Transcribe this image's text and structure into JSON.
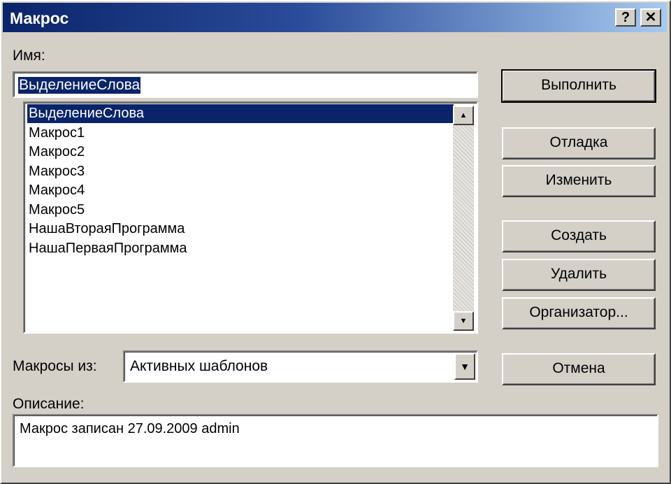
{
  "window": {
    "title": "Макрос",
    "help_label": "?",
    "close_label": "✕"
  },
  "name_label": "Имя:",
  "name_value": "ВыделениеСлова",
  "macros": [
    "ВыделениеСлова",
    "Макрос1",
    "Макрос2",
    "Макрос3",
    "Макрос4",
    "Макрос5",
    "НашаВтораяПрограмма",
    "НашаПерваяПрограмма"
  ],
  "selected_index": 0,
  "scroll": {
    "up_glyph": "▲",
    "down_glyph": "▼"
  },
  "buttons": {
    "run": "Выполнить",
    "debug": "Отладка",
    "edit": "Изменить",
    "create": "Создать",
    "delete": "Удалить",
    "organizer": "Организатор...",
    "cancel": "Отмена"
  },
  "macros_in_label": "Макросы из:",
  "macros_in_value": "Активных шаблонов",
  "dropdown_glyph": "▼",
  "description_label": "Описание:",
  "description_value": "Макрос записан 27.09.2009 admin",
  "colors": {
    "title_start": "#0a246a",
    "title_end": "#a6caf0",
    "selection": "#0a246a",
    "face": "#d4d0c8"
  }
}
